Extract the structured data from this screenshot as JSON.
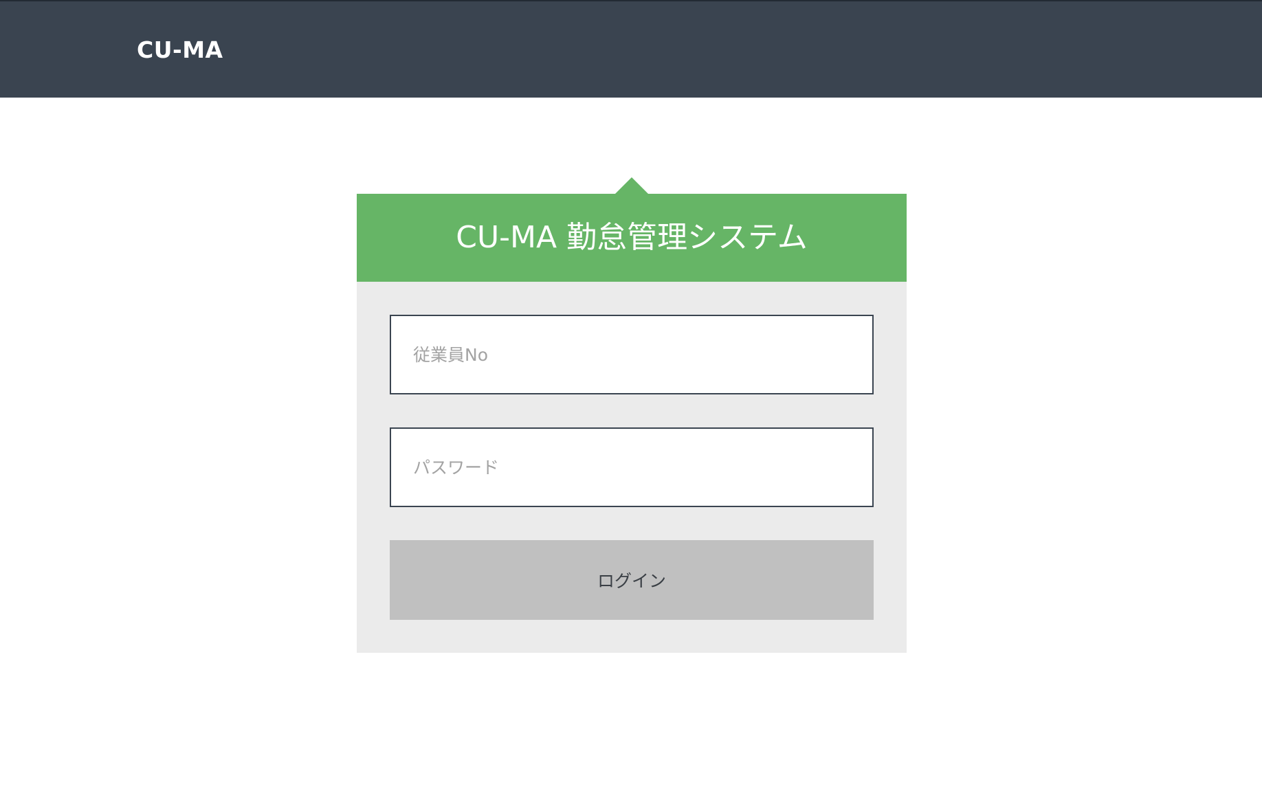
{
  "header": {
    "brand": "CU-MA"
  },
  "login_card": {
    "title": "CU-MA 勤怠管理システム",
    "employee_no": {
      "value": "",
      "placeholder": "従業員No"
    },
    "password": {
      "value": "",
      "placeholder": "パスワード"
    },
    "submit_label": "ログイン"
  },
  "colors": {
    "header_bg": "#3a4450",
    "card_header_bg": "#66b566",
    "card_bg": "#ebebeb",
    "button_bg": "#c0c0c0"
  }
}
